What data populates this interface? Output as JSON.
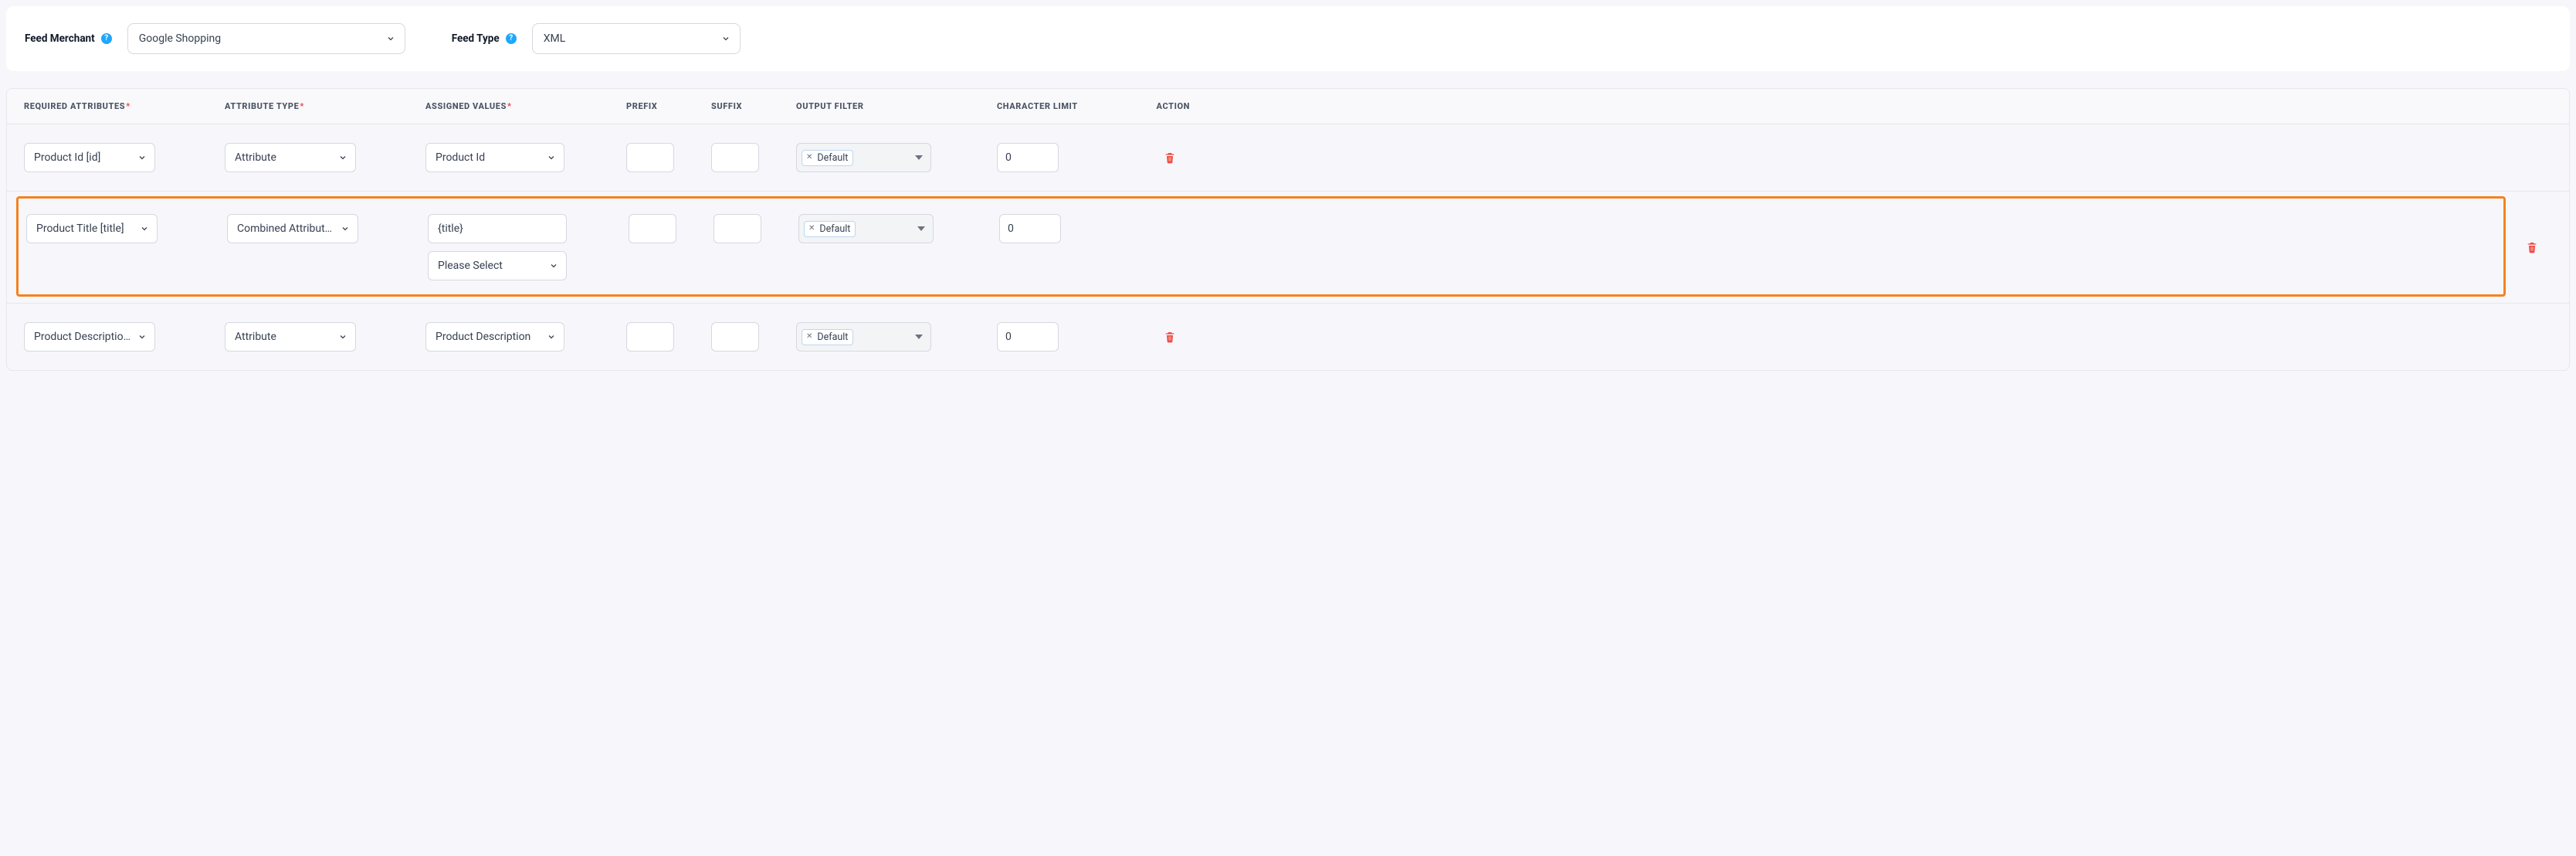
{
  "header": {
    "feed_merchant_label": "Feed Merchant",
    "feed_merchant_value": "Google Shopping",
    "feed_type_label": "Feed Type",
    "feed_type_value": "XML"
  },
  "columns": {
    "required_attributes": "REQUIRED ATTRIBUTES",
    "attribute_type": "ATTRIBUTE TYPE",
    "assigned_values": "ASSIGNED VALUES",
    "prefix": "PREFIX",
    "suffix": "SUFFIX",
    "output_filter": "OUTPUT FILTER",
    "character_limit": "CHARACTER LIMIT",
    "action": "ACTION",
    "asterisk": "*"
  },
  "rows": [
    {
      "required_attribute": "Product Id [id]",
      "attribute_type": "Attribute",
      "assigned_value_main": "Product Id",
      "assigned_value_extra": null,
      "prefix": "",
      "suffix": "",
      "output_filter_tag": "Default",
      "character_limit": "0",
      "highlighted": false
    },
    {
      "required_attribute": "Product Title [title]",
      "attribute_type": "Combined Attributes",
      "assigned_value_main": "{title}",
      "assigned_value_extra": "Please Select",
      "prefix": "",
      "suffix": "",
      "output_filter_tag": "Default",
      "character_limit": "0",
      "highlighted": true
    },
    {
      "required_attribute": "Product Description [description]",
      "attribute_type": "Attribute",
      "assigned_value_main": "Product Description",
      "assigned_value_extra": null,
      "prefix": "",
      "suffix": "",
      "output_filter_tag": "Default",
      "character_limit": "0",
      "highlighted": false
    }
  ]
}
